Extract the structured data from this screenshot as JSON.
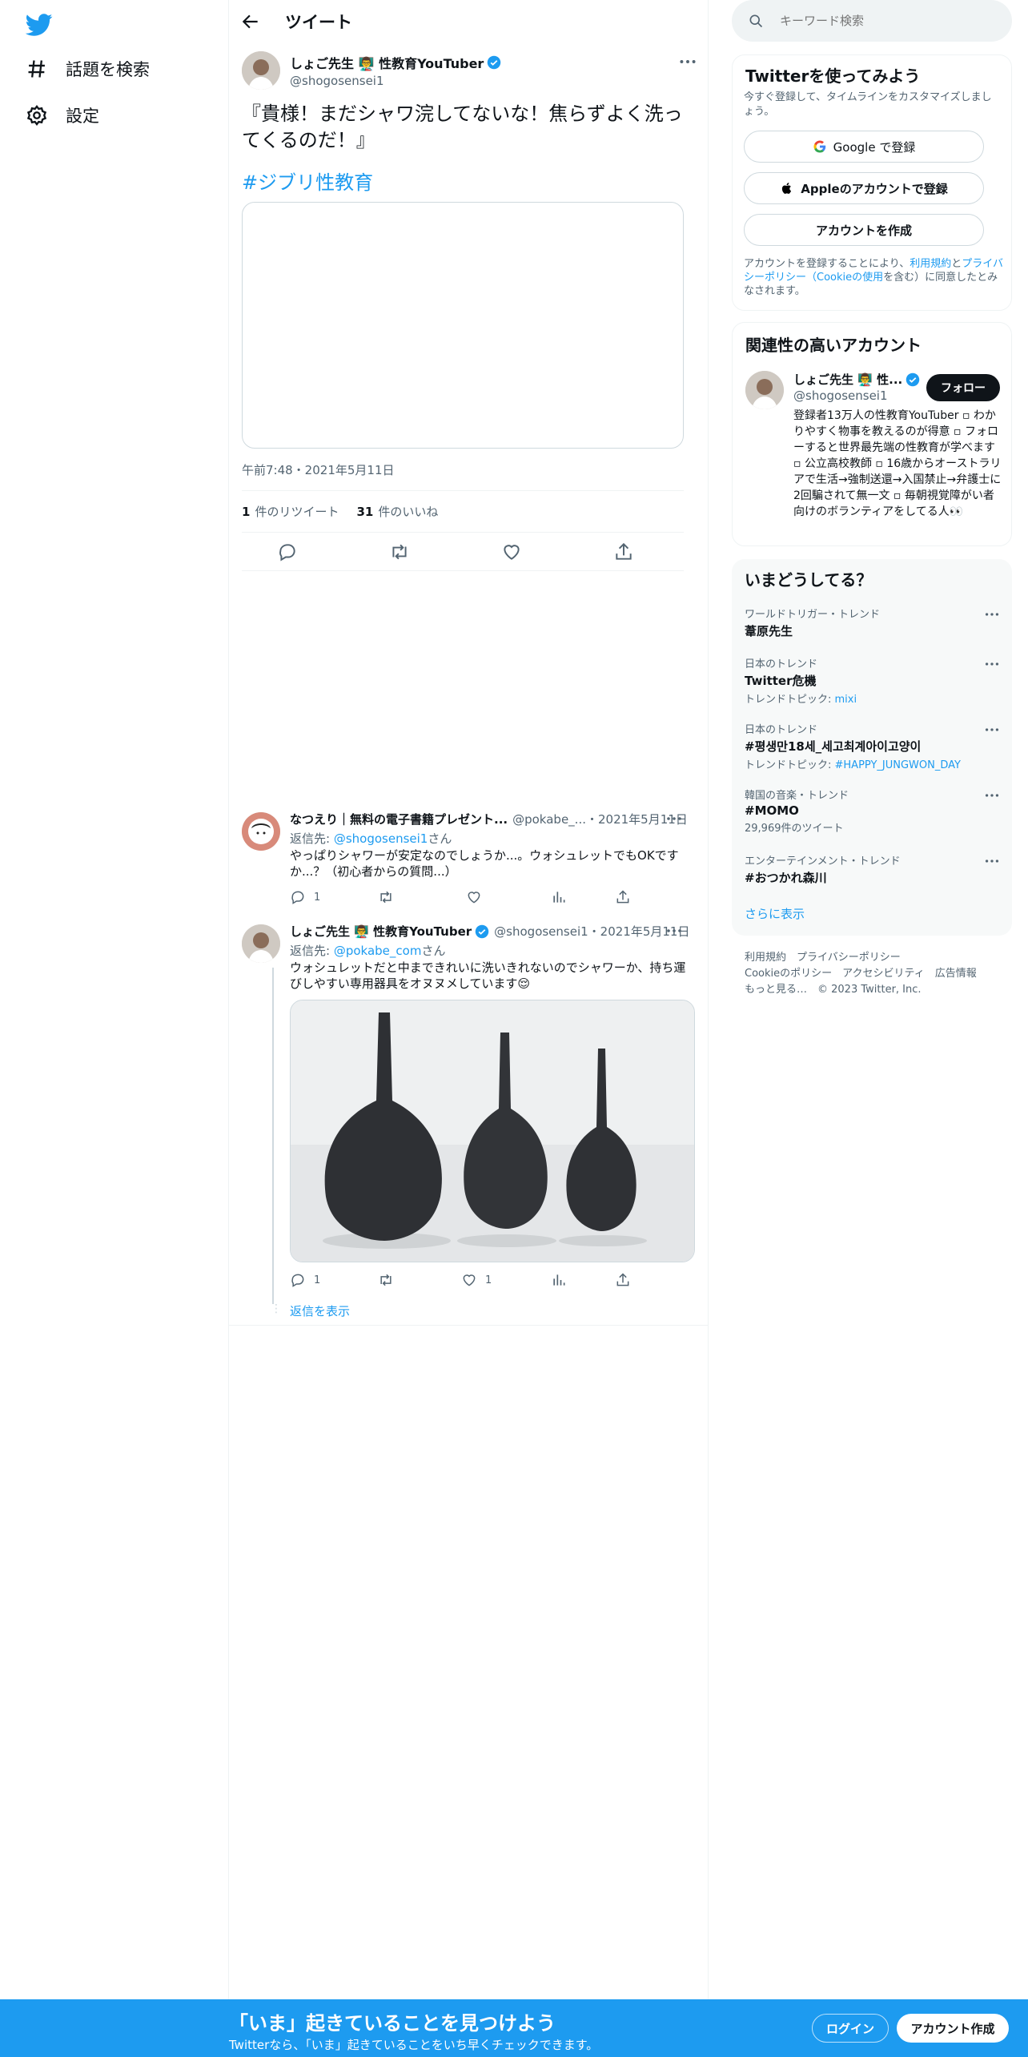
{
  "nav": {
    "explore": "話題を検索",
    "settings": "設定"
  },
  "header": {
    "title": "ツイート"
  },
  "tweet": {
    "author_name": "しょご先生 👨‍🏫 性教育YouTuber",
    "handle": "@shogosensei1",
    "text": "『貴様！まだシャワ浣してないな！焦らずよく洗ってくるのだ！』",
    "hashtag": "#ジブリ性教育",
    "time": "午前7:48・2021年5月11日",
    "retweets_count": "1",
    "retweets_label": "件のリツイート",
    "likes_count": "31",
    "likes_label": "件のいいね"
  },
  "replies": [
    {
      "author_name": "なつえり｜無料の電子書籍プレゼント...",
      "handle_date": "@pokabe_...・2021年5月11日",
      "reply_to_prefix": "返信先:",
      "reply_to": "@shogosensei1",
      "reply_to_suffix": "さん",
      "text": "やっぱりシャワーが安定なのでしょうか...。ウォシュレットでもOKですか...？（初心者からの質問...）",
      "reply_count": "1",
      "like_count": ""
    },
    {
      "author_name": "しょご先生 👨‍🏫 性教育YouTuber",
      "handle_date": "@shogosensei1・2021年5月11日",
      "reply_to_prefix": "返信先:",
      "reply_to": "@pokabe_com",
      "reply_to_suffix": "さん",
      "text": "ウォシュレットだと中まできれいに洗いきれないのでシャワーか、持ち運びしやすい専用器具をオヌヌメしています😌",
      "reply_count": "1",
      "like_count": "1"
    }
  ],
  "show_replies": "返信を表示",
  "search": {
    "placeholder": "キーワード検索"
  },
  "signup": {
    "title": "Twitterを使ってみよう",
    "desc": "今すぐ登録して、タイムラインをカスタマイズしましょう。",
    "google": "Google で登録",
    "apple": "Appleのアカウントで登録",
    "create": "アカウントを作成",
    "terms_1": "アカウントを登録することにより、",
    "terms_link1": "利用規約",
    "terms_2": "と",
    "terms_link2": "プライバシーポリシー（Cookieの使用",
    "terms_3": "を含む）に同意したとみなされます。"
  },
  "related": {
    "title": "関連性の高いアカウント",
    "name": "しょご先生 👨‍🏫 性...",
    "handle": "@shogosensei1",
    "follow": "フォロー",
    "bio": "登録者13万人の性教育YouTuber ▫ わかりやすく物事を教えるのが得意 ▫ フォローすると世界最先端の性教育が学べます ▫ 公立高校教師 ▫ 16歳からオーストラリアで生活→強制送還→入国禁止→弁護士に2回騙されて無一文 ▫ 毎朝視覚障がい者向けのボランティアをしてる人👀"
  },
  "trends": {
    "title": "いまどうしてる？",
    "items": [
      {
        "category": "ワールドトリガー・トレンド",
        "name": "葦原先生",
        "sub_prefix": "",
        "sub_link": ""
      },
      {
        "category": "日本のトレンド",
        "name": "Twitter危機",
        "sub_prefix": "トレンドトピック: ",
        "sub_link": "mixi"
      },
      {
        "category": "日本のトレンド",
        "name": "#평생만18세_세고최계아이고양이",
        "sub_prefix": "トレンドトピック: ",
        "sub_link": "#HAPPY_JUNGWON_DAY"
      },
      {
        "category": "韓国の音楽・トレンド",
        "name": "#MOMO",
        "sub_prefix": "29,969件のツイート",
        "sub_link": ""
      },
      {
        "category": "エンターテインメント・トレンド",
        "name": "#おつかれ森川",
        "sub_prefix": "",
        "sub_link": ""
      }
    ],
    "show_more": "さらに表示"
  },
  "footer": {
    "line1": "利用規約　プライバシーポリシー",
    "line2": "Cookieのポリシー　アクセシビリティ　広告情報",
    "line3": "もっと見る…　© 2023 Twitter, Inc."
  },
  "banner": {
    "title": "「いま」起きていることを見つけよう",
    "subtitle": "Twitterなら、「いま」起きていることをいち早くチェックできます。",
    "login": "ログイン",
    "signup": "アカウント作成"
  },
  "colors": {
    "accent": "#1d9bf0",
    "text": "#0f1419",
    "muted": "#536471"
  }
}
